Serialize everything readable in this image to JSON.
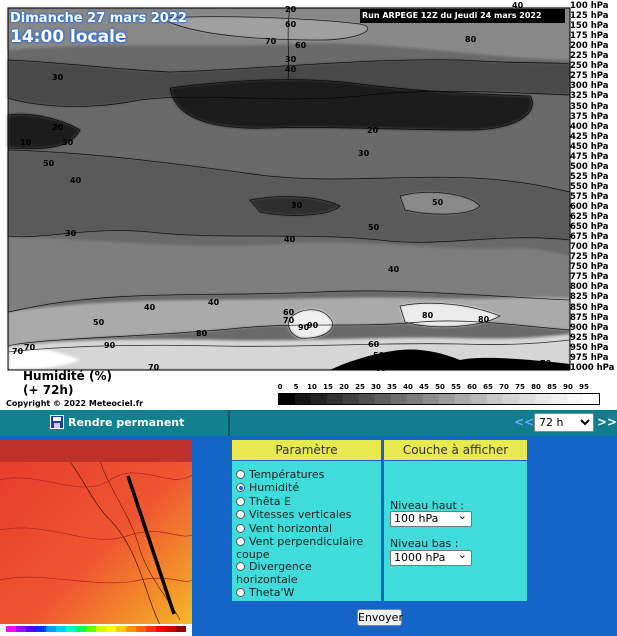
{
  "plot": {
    "date": "Dimanche 27 mars 2022",
    "local_time": "14:00 locale",
    "run": "Run ARPEGE 12Z du Jeudi 24 mars 2022",
    "param_name": "Humidité (%)",
    "lead_time": "(+ 72h)",
    "copyright": "Copyright © 2022 Meteociel.fr",
    "scale_values": [
      "0",
      "5",
      "10",
      "15",
      "20",
      "25",
      "30",
      "35",
      "40",
      "45",
      "50",
      "55",
      "60",
      "65",
      "70",
      "75",
      "80",
      "85",
      "90",
      "95"
    ],
    "scale_colors": [
      "#000000",
      "#141414",
      "#232323",
      "#323232",
      "#414141",
      "#505050",
      "#5f5f5f",
      "#6e6e6e",
      "#7d7d7d",
      "#8c8c8c",
      "#9b9b9b",
      "#aaaaaa",
      "#b9b9b9",
      "#c8c8c8",
      "#d4d4d4",
      "#dedede",
      "#e8e8e8",
      "#f0f0f0",
      "#f7f7f7",
      "#ffffff"
    ],
    "pressure_levels": [
      "100 hPa",
      "125 hPa",
      "150 hPa",
      "175 hPa",
      "200 hPa",
      "225 hPa",
      "250 hPa",
      "275 hPa",
      "300 hPa",
      "325 hPa",
      "350 hPa",
      "375 hPa",
      "400 hPa",
      "425 hPa",
      "450 hPa",
      "475 hPa",
      "500 hPa",
      "525 hPa",
      "550 hPa",
      "575 hPa",
      "600 hPa",
      "625 hPa",
      "650 hPa",
      "675 hPa",
      "700 hPa",
      "725 hPa",
      "750 hPa",
      "775 hPa",
      "800 hPa",
      "825 hPa",
      "850 hPa",
      "875 hPa",
      "900 hPa",
      "925 hPa",
      "950 hPa",
      "975 hPa",
      "1000 hPa"
    ],
    "contour_labels": [
      "30",
      "20",
      "60",
      "70",
      "80",
      "60",
      "40",
      "30",
      "10",
      "20",
      "30",
      "20",
      "30",
      "50",
      "40",
      "30",
      "50",
      "30",
      "40",
      "50",
      "40",
      "40",
      "40",
      "60",
      "70",
      "50",
      "80",
      "90",
      "80",
      "90",
      "90",
      "70",
      "70",
      "80",
      "60",
      "50",
      "70",
      "60",
      "70",
      "40"
    ]
  },
  "toolbar": {
    "save_label": "Rendre permanent",
    "prev": "<<",
    "next": ">>",
    "hour_selected": "72 h"
  },
  "form": {
    "param_header": "Paramètre",
    "layer_header": "Couche à afficher",
    "params": [
      "Températures",
      "Humidité",
      "Thêta E",
      "Vitesses verticales",
      "Vent horizontal",
      "Vent perpendiculaire coupe",
      "Divergence horizontale",
      "Theta'W"
    ],
    "selected_param": "Humidité",
    "top_level_label": "Niveau haut :",
    "top_level_value": "100 hPa",
    "bottom_level_label": "Niveau bas :",
    "bottom_level_value": "1000 hPa",
    "submit": "Envoyer"
  }
}
